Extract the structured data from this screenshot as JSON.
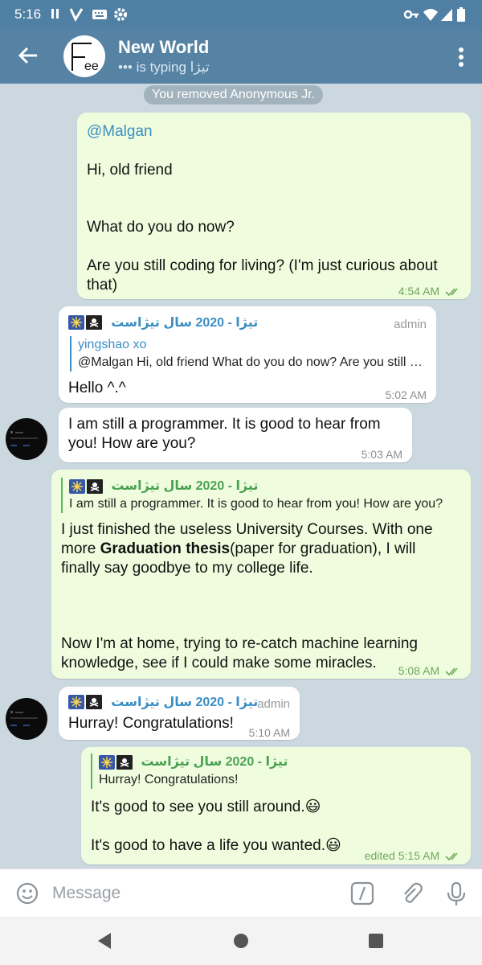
{
  "status_bar": {
    "time": "5:16"
  },
  "header": {
    "title": "New World",
    "subtitle": "••• is typing تیژا",
    "avatar_text": "ee"
  },
  "chat": {
    "service_message": "You removed Anonymous Jr.",
    "messages": [
      {
        "mention": "@Malgan",
        "line1": "Hi, old friend",
        "line2": "What do you do now?",
        "line3": "Are you still coding for living? (I'm just curious about",
        "line4": "that)",
        "time": "4:54 AM"
      },
      {
        "sender": "تیژا - 2020 سال تیژاست",
        "badge": "admin",
        "reply_name": "yingshao xo",
        "reply_text": "@Malgan   Hi, old friend   What do you do now?  Are you still coding for living?",
        "text": "Hello ^.^",
        "time": "5:02 AM"
      },
      {
        "line1": "I am still a programmer. It is good to hear from",
        "line2": "you! How are you?",
        "time": "5:03 AM"
      },
      {
        "reply_name": "تیژا - 2020 سال تیژاست",
        "reply_text": "I am still a programmer. It is good to hear from you! How are you?",
        "line1": "I just finished the useless University Courses. With one",
        "line2_pre": "more ",
        "line2_bold": "Graduation thesis",
        "line2_post": "(paper for graduation), I will",
        "line3": "finally say goodbye to my college life.",
        "line4": "Now I'm at home, trying to re-catch machine learning",
        "line5": "knowledge, see if I could make some miracles.",
        "time": "5:08 AM"
      },
      {
        "sender": "تیژا - 2020 سال تیژاست",
        "badge": "admin",
        "text": "Hurray! Congratulations!",
        "time": "5:10 AM"
      },
      {
        "reply_name": "تیژا - 2020 سال تیژاست",
        "reply_text": "Hurray! Congratulations!",
        "line1": "It's good to see you still around.😃",
        "line2": "It's good to have a life you wanted.😃",
        "time": "edited 5:15 AM"
      }
    ]
  },
  "input": {
    "placeholder": "Message"
  },
  "icons": {
    "status": [
      "pause-icon",
      "v-icon",
      "keyboard-icon",
      "gear-icon",
      "key-icon",
      "wifi-icon",
      "signal-icon",
      "battery-icon"
    ],
    "header": [
      "back-arrow-icon",
      "more-vert-icon"
    ],
    "input": [
      "emoji-icon",
      "command-icon",
      "attach-icon",
      "mic-icon"
    ],
    "nav": [
      "back-triangle-icon",
      "home-circle-icon",
      "recents-square-icon"
    ]
  },
  "colors": {
    "header": "#5682a3",
    "status_bar": "#4f7fa3",
    "outgoing_bubble": "#effdde",
    "incoming_bubble": "#ffffff",
    "chat_bg": "#ccd8df",
    "name_blue": "#3a8ec3",
    "name_green": "#4aa152",
    "time_green": "#6ca85a"
  }
}
